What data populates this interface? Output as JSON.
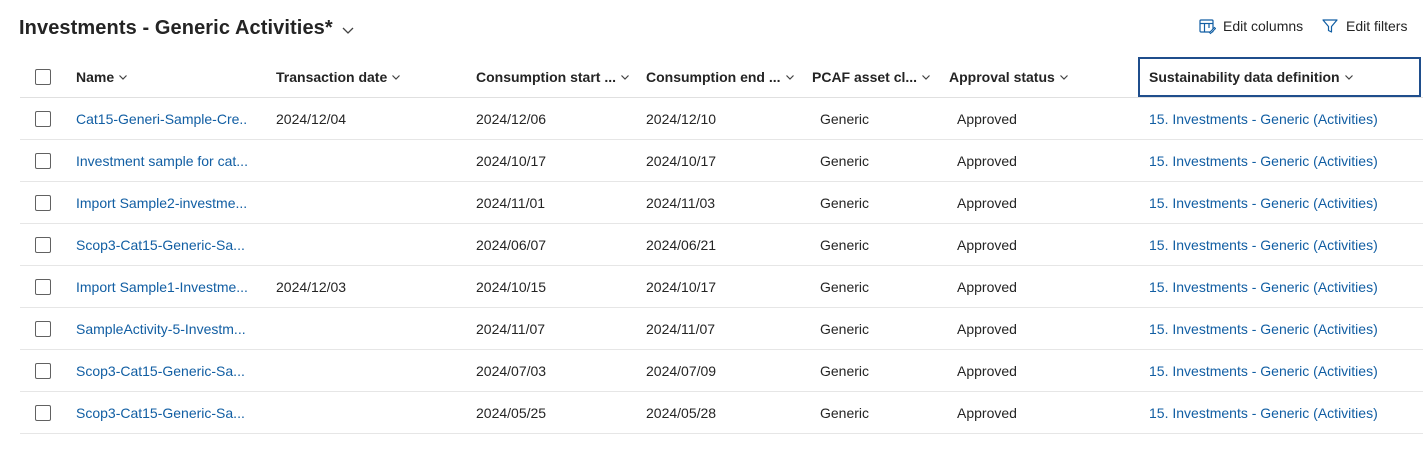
{
  "header": {
    "view_title": "Investments - Generic Activities*",
    "edit_columns_label": "Edit columns",
    "edit_filters_label": "Edit filters"
  },
  "columns": {
    "name": "Name",
    "transaction_date": "Transaction date",
    "consumption_start": "Consumption start ...",
    "consumption_end": "Consumption end ...",
    "pcaf": "PCAF asset cl...",
    "approval": "Approval status",
    "sdd": "Sustainability data definition"
  },
  "rows": [
    {
      "name": "Cat15-Generi-Sample-Cre...",
      "transaction_date": "2024/12/04",
      "consumption_start": "2024/12/06",
      "consumption_end": "2024/12/10",
      "pcaf": "Generic",
      "approval": "Approved",
      "sdd": "15. Investments - Generic (Activities)"
    },
    {
      "name": "Investment sample for cat...",
      "transaction_date": "",
      "consumption_start": "2024/10/17",
      "consumption_end": "2024/10/17",
      "pcaf": "Generic",
      "approval": "Approved",
      "sdd": "15. Investments - Generic (Activities)"
    },
    {
      "name": "Import Sample2-investme...",
      "transaction_date": "",
      "consumption_start": "2024/11/01",
      "consumption_end": "2024/11/03",
      "pcaf": "Generic",
      "approval": "Approved",
      "sdd": "15. Investments - Generic (Activities)"
    },
    {
      "name": "Scop3-Cat15-Generic-Sa...",
      "transaction_date": "",
      "consumption_start": "2024/06/07",
      "consumption_end": "2024/06/21",
      "pcaf": "Generic",
      "approval": "Approved",
      "sdd": "15. Investments - Generic (Activities)"
    },
    {
      "name": "Import Sample1-Investme...",
      "transaction_date": "2024/12/03",
      "consumption_start": "2024/10/15",
      "consumption_end": "2024/10/17",
      "pcaf": "Generic",
      "approval": "Approved",
      "sdd": "15. Investments - Generic (Activities)"
    },
    {
      "name": "SampleActivity-5-Investm...",
      "transaction_date": "",
      "consumption_start": "2024/11/07",
      "consumption_end": "2024/11/07",
      "pcaf": "Generic",
      "approval": "Approved",
      "sdd": "15. Investments - Generic (Activities)"
    },
    {
      "name": "Scop3-Cat15-Generic-Sa...",
      "transaction_date": "",
      "consumption_start": "2024/07/03",
      "consumption_end": "2024/07/09",
      "pcaf": "Generic",
      "approval": "Approved",
      "sdd": "15. Investments - Generic (Activities)"
    },
    {
      "name": "Scop3-Cat15-Generic-Sa...",
      "transaction_date": "",
      "consumption_start": "2024/05/25",
      "consumption_end": "2024/05/28",
      "pcaf": "Generic",
      "approval": "Approved",
      "sdd": "15. Investments - Generic (Activities)"
    }
  ],
  "colors": {
    "link": "#115ea3",
    "focus_border": "#1f4e8c",
    "text": "#242424",
    "row_border": "#e6e6e6"
  },
  "icons": {
    "view_selector": "chevron-down-icon",
    "edit_columns": "edit-columns-icon",
    "edit_filters": "filter-icon",
    "sort": "chevron-down-icon"
  }
}
